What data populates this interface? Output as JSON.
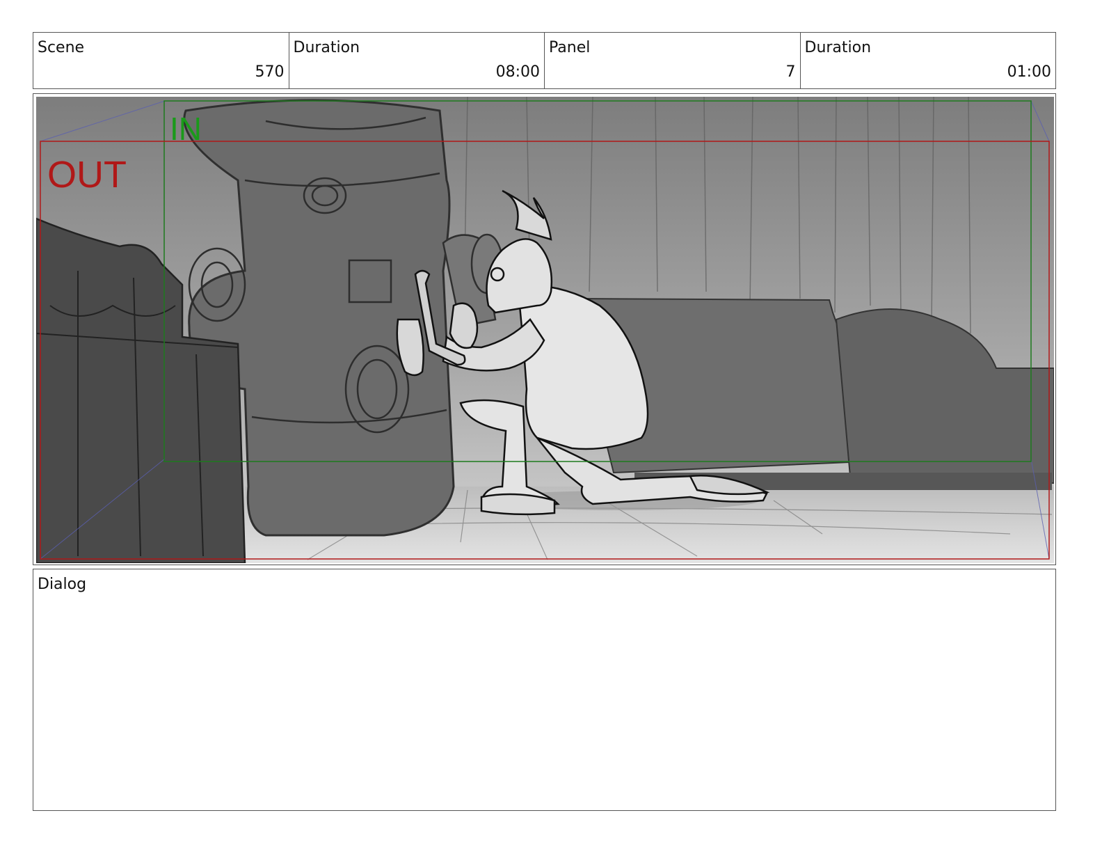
{
  "header": {
    "scene_label": "Scene",
    "scene_value": "570",
    "scene_duration_label": "Duration",
    "scene_duration_value": "08:00",
    "panel_label": "Panel",
    "panel_value": "7",
    "panel_duration_label": "Duration",
    "panel_duration_value": "01:00"
  },
  "frame": {
    "in_label": "IN",
    "out_label": "OUT",
    "in_color": "#1a9a1a",
    "out_color": "#b01818"
  },
  "dialog": {
    "label": "Dialog",
    "text": ""
  }
}
